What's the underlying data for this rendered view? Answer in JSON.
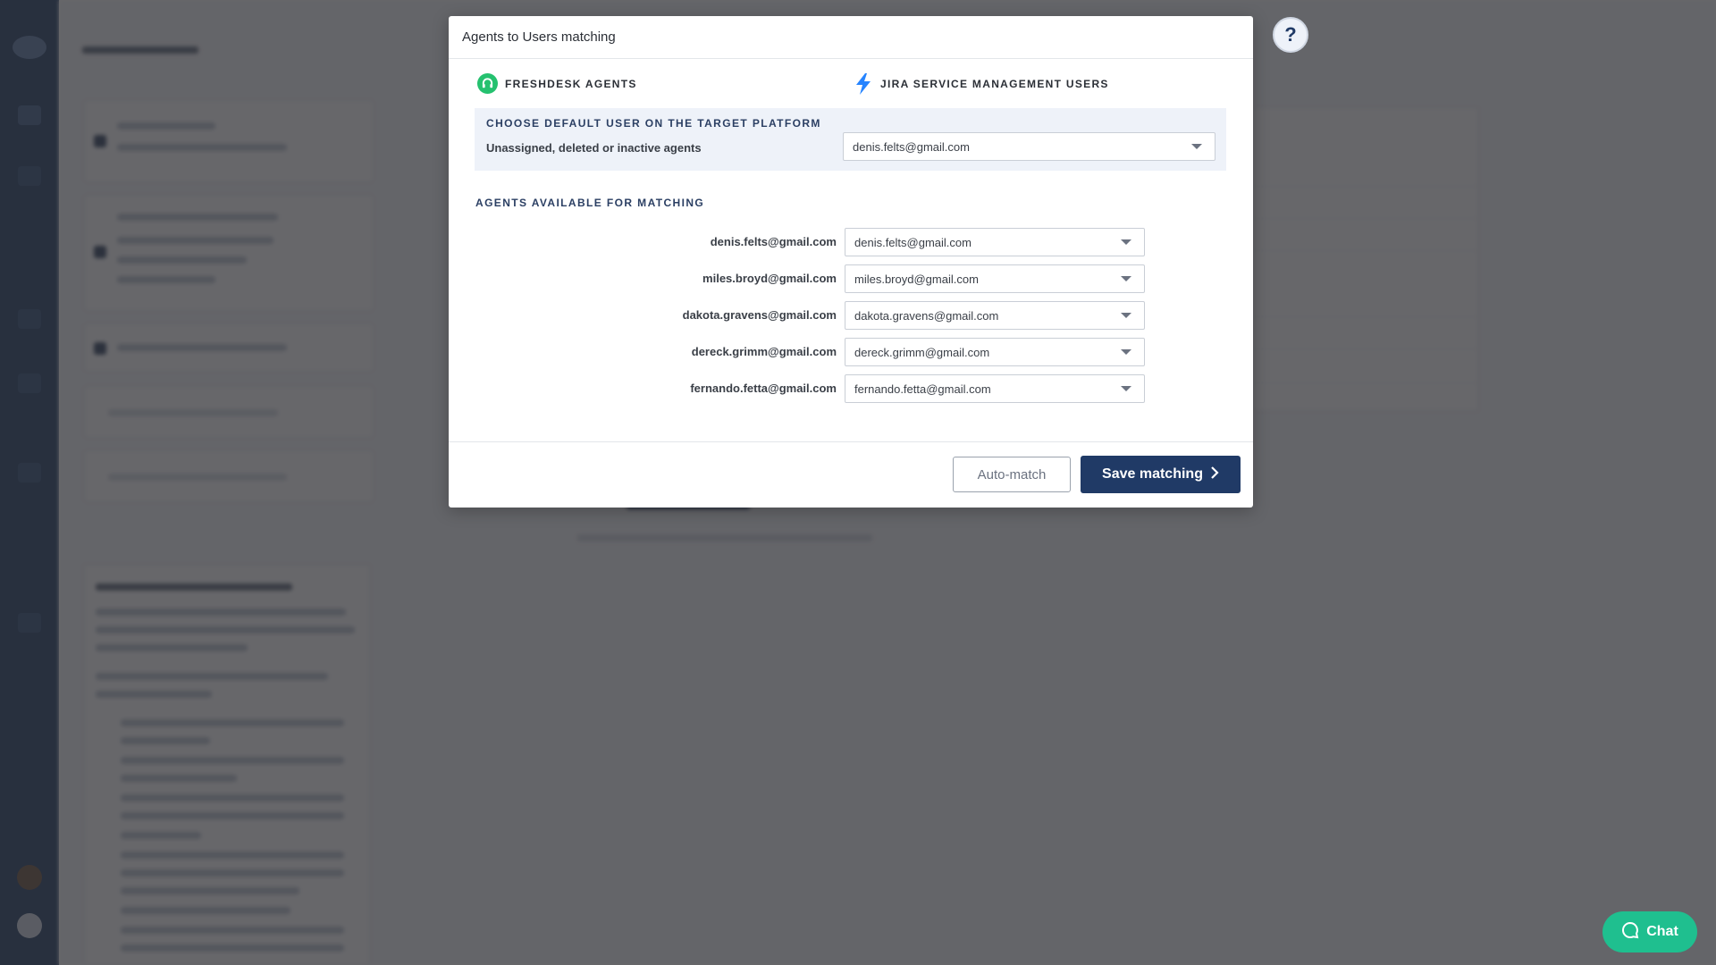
{
  "modal": {
    "title": "Agents to Users matching",
    "source_platform": "FRESHDESK AGENTS",
    "target_platform": "JIRA SERVICE MANAGEMENT USERS",
    "default_section_title": "CHOOSE DEFAULT USER ON THE TARGET PLATFORM",
    "default_label": "Unassigned, deleted or inactive agents",
    "default_value": "denis.felts@gmail.com",
    "matching_section_title": "AGENTS AVAILABLE FOR MATCHING",
    "rows": [
      {
        "agent": "denis.felts@gmail.com",
        "user": "denis.felts@gmail.com"
      },
      {
        "agent": "miles.broyd@gmail.com",
        "user": "miles.broyd@gmail.com"
      },
      {
        "agent": "dakota.gravens@gmail.com",
        "user": "dakota.gravens@gmail.com"
      },
      {
        "agent": "dereck.grimm@gmail.com",
        "user": "dereck.grimm@gmail.com"
      },
      {
        "agent": "fernando.fetta@gmail.com",
        "user": "fernando.fetta@gmail.com"
      }
    ],
    "auto_match_label": "Auto-match",
    "save_label": "Save matching"
  },
  "help": {
    "label": "?"
  },
  "chat": {
    "label": "Chat"
  },
  "icons": {
    "freshdesk": "headset-icon",
    "jira": "lightning-icon",
    "caret": "chevron-down-icon",
    "save_arrow": "chevron-right-icon",
    "chat": "chat-bubble-icon"
  },
  "colors": {
    "primary": "#203a66",
    "freshdesk_green": "#25c16f",
    "jira_blue": "#2684ff",
    "chat_green": "#1fbf8f",
    "overlay": "#2d2d30"
  }
}
